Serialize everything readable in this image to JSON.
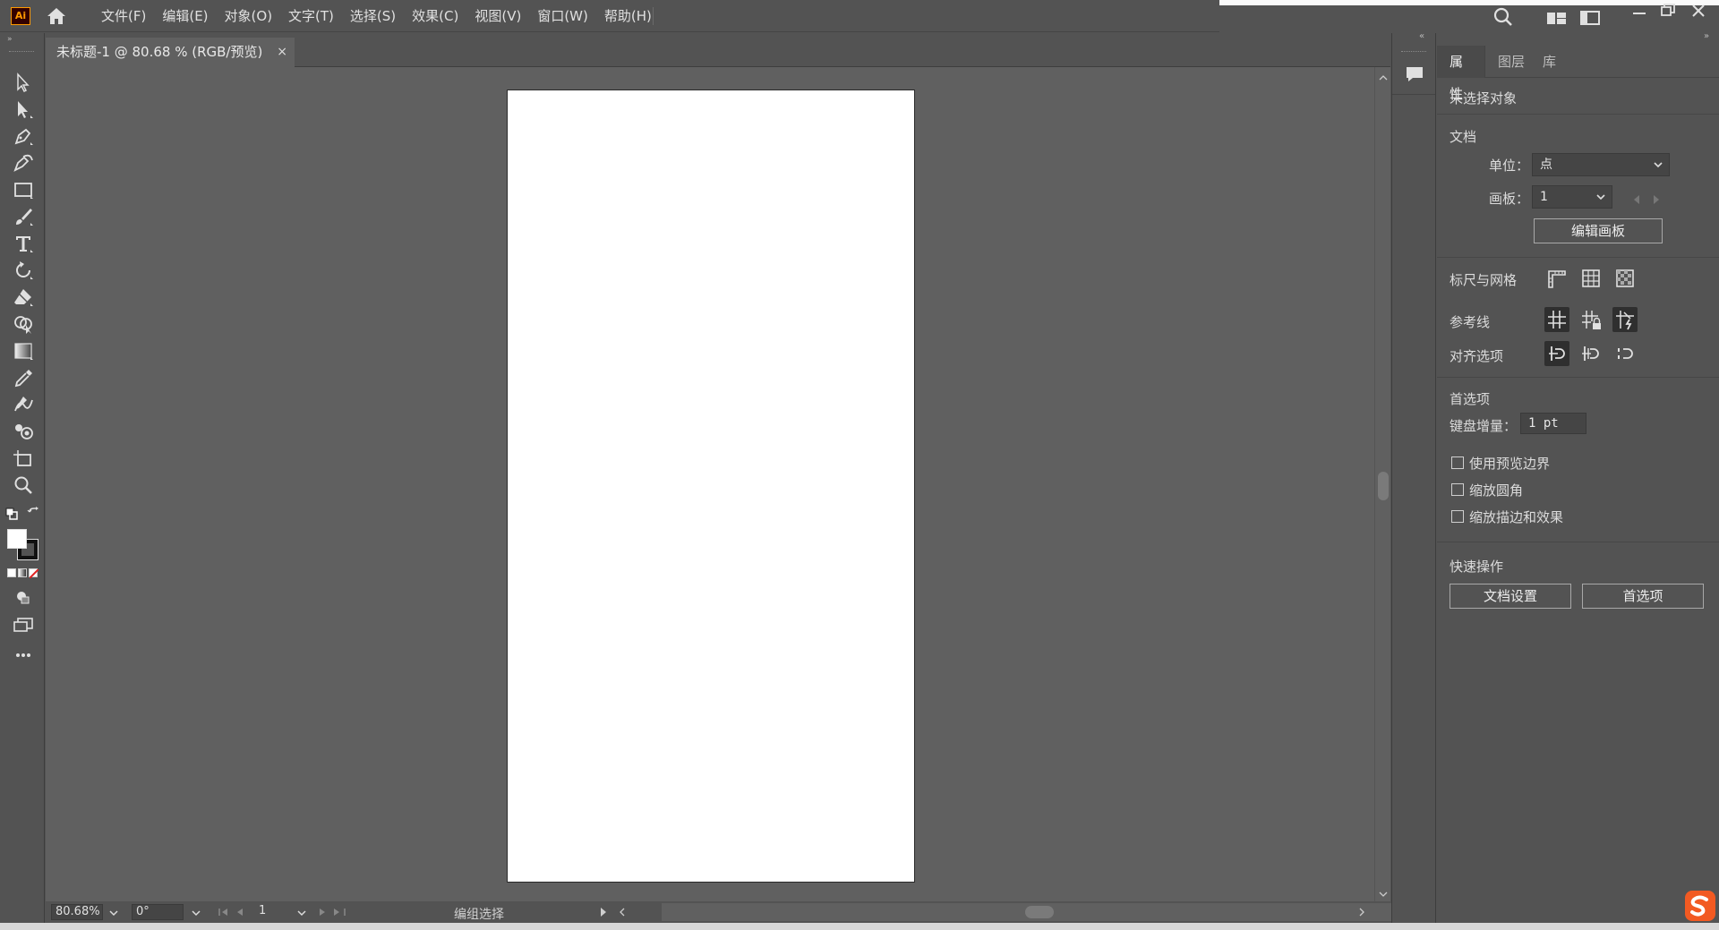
{
  "app": {
    "logo": "Ai",
    "home_icon": "home-icon"
  },
  "menus": [
    "文件(F)",
    "编辑(E)",
    "对象(O)",
    "文字(T)",
    "选择(S)",
    "效果(C)",
    "视图(V)",
    "窗口(W)",
    "帮助(H)"
  ],
  "document": {
    "tab_title": "未标题-1 @ 80.68 % (RGB/预览)",
    "close": "×"
  },
  "status": {
    "zoom": "80.68%",
    "rotation": "0°",
    "artboard": "1",
    "mode": "编组选择"
  },
  "panel": {
    "tabs": [
      "属性",
      "图层",
      "库"
    ],
    "active_tab": "属性",
    "no_selection": "未选择对象",
    "document_section": "文档",
    "units_label": "单位：",
    "units_value": "点",
    "artboard_label": "画板：",
    "artboard_value": "1",
    "edit_artboard_button": "编辑画板",
    "rulers_grid_label": "标尺与网格",
    "guides_label": "参考线",
    "align_label": "对齐选项",
    "preferences_section": "首选项",
    "keyboard_increment_label": "键盘增量：",
    "keyboard_increment_value": "1 pt",
    "use_preview_bounds": "使用预览边界",
    "scale_corners": "缩放圆角",
    "scale_strokes": "缩放描边和效果",
    "quick_actions_section": "快速操作",
    "document_setup_button": "文档设置",
    "preferences_button": "首选项"
  },
  "colors": {
    "chrome": "#535353",
    "canvas": "#606060",
    "artboard": "#ffffff",
    "accent_logo": "#ff9a00"
  }
}
